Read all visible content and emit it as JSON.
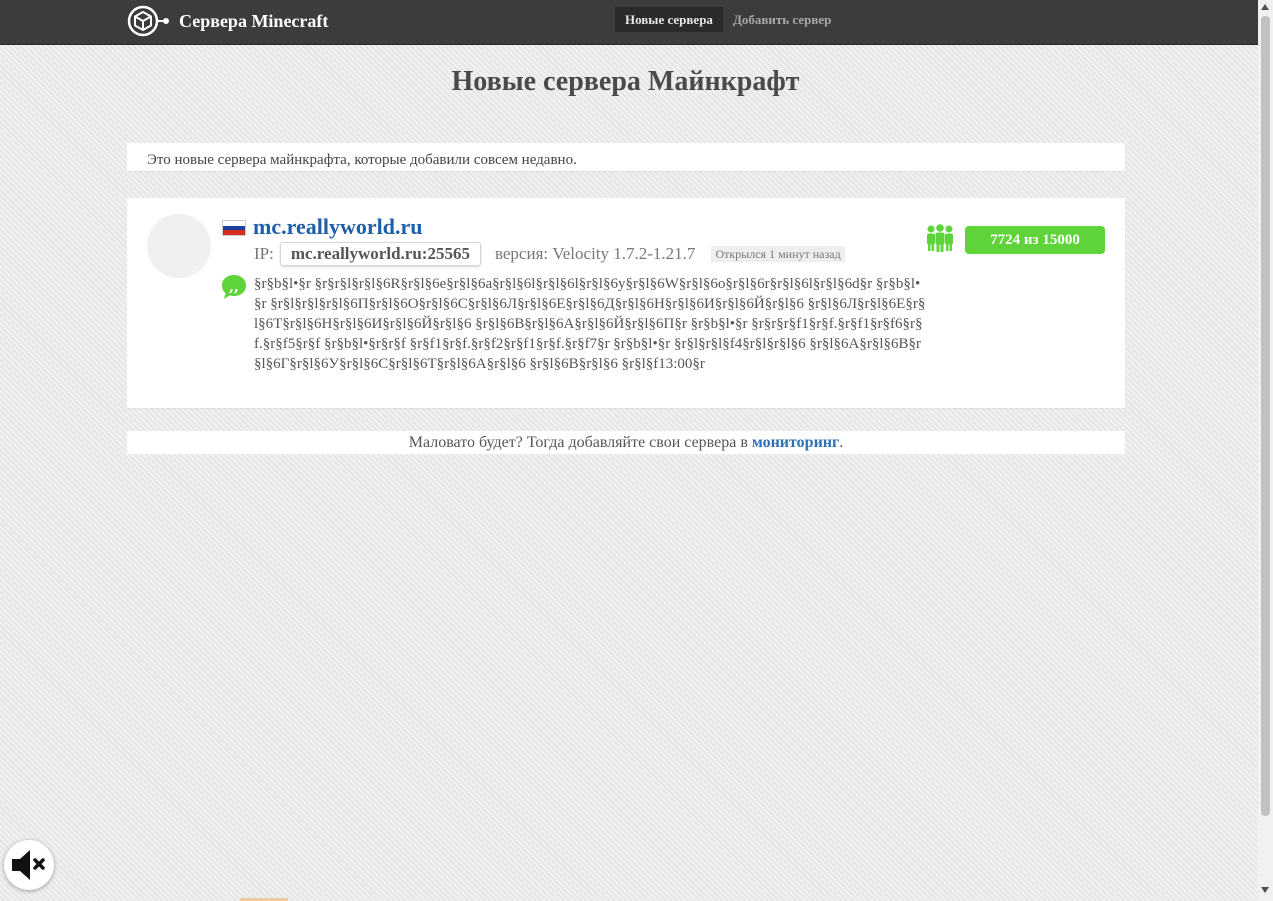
{
  "header": {
    "site_title": "Сервера Minecraft",
    "logo_icon": "cube-icon",
    "nav": [
      {
        "label": "Новые сервера",
        "active": true
      },
      {
        "label": "Добавить сервер",
        "active": false
      }
    ]
  },
  "main": {
    "heading": "Новые сервера Майнкрафт",
    "intro": "Это новые сервера майнкрафта, которые добавили совсем недавно."
  },
  "server": {
    "name": "mc.reallyworld.ru",
    "country_flag": "russia-flag-icon",
    "ip_label": "IP:",
    "ip": "mc.reallyworld.ru:25565",
    "version": "версия: Velocity 1.7.2-1.21.7",
    "opened": "Открылся 1 минут назад",
    "motd": "§r§b§l•§r §r§r§l§r§l§6R§r§l§6e§r§l§6a§r§l§6l§r§l§6l§r§l§6y§r§l§6W§r§l§6o§r§l§6r§r§l§6l§r§l§6d§r §r§b§l•§r §r§l§r§l§r§l§6П§r§l§6О§r§l§6С§r§l§6Л§r§l§6Е§r§l§6Д§r§l§6Н§r§l§6И§r§l§6Й§r§l§6 §r§l§6Л§r§l§6Е§r§l§6Т§r§l§6Н§r§l§6И§r§l§6Й§r§l§6 §r§l§6В§r§l§6А§r§l§6Й§r§l§6П§r §r§b§l•§r §r§r§r§f1§r§f.§r§f1§r§f6§r§f.§r§f5§r§f §r§b§l•§r§r§f §r§f1§r§f.§r§f2§r§f1§r§f.§r§f7§r §r§b§l•§r §r§l§r§l§f4§r§l§r§l§6 §r§l§6А§r§l§6В§r§l§6Г§r§l§6У§r§l§6С§r§l§6Т§r§l§6А§r§l§6 §r§l§6В§r§l§6 §r§l§f13:00§r",
    "players": "7724 из 15000",
    "players_online": 7724,
    "players_max": 15000,
    "players_icon": "players-icon",
    "motd_icon": "quote-icon",
    "badge_color": "#5fd43a"
  },
  "footer": {
    "text_before": "Маловато будет? Тогда добавляйте свои сервера в ",
    "link_label": "мониторинг",
    "text_after": "."
  },
  "controls": {
    "mute_icon": "speaker-muted-icon"
  }
}
